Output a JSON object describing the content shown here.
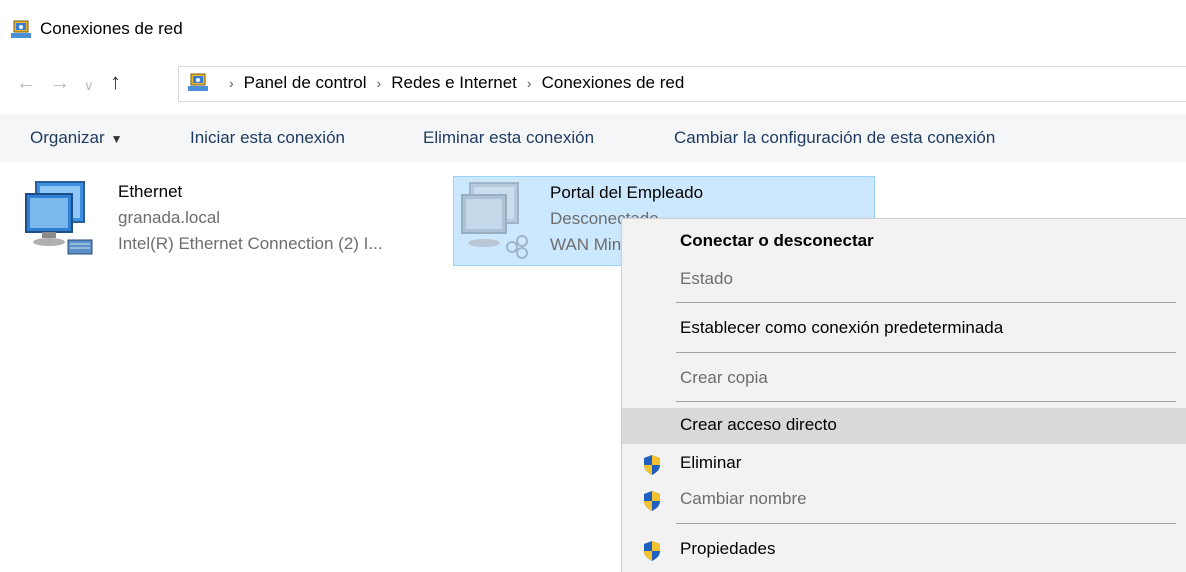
{
  "window": {
    "title": "Conexiones de red"
  },
  "address": {
    "crumbs": [
      "Panel de control",
      "Redes e Internet",
      "Conexiones de red"
    ]
  },
  "nav": {
    "back": "←",
    "forward": "→",
    "recent": "∨",
    "up": "↑"
  },
  "toolbar": {
    "organize": "Organizar",
    "start": "Iniciar esta conexión",
    "delete": "Eliminar esta conexión",
    "change": "Cambiar la configuración de esta conexión"
  },
  "connections": [
    {
      "name": "Ethernet",
      "line1": "granada.local",
      "line2": "Intel(R) Ethernet Connection (2) I..."
    },
    {
      "name": "Portal del Empleado",
      "line1": "Desconectado",
      "line2": "WAN Miniport (PPTP)"
    }
  ],
  "context_menu": {
    "connect": "Conectar o desconectar",
    "status": "Estado",
    "set_default": "Establecer como conexión predeterminada",
    "copy": "Crear copia",
    "shortcut": "Crear acceso directo",
    "delete": "Eliminar",
    "rename": "Cambiar nombre",
    "properties": "Propiedades"
  },
  "colors": {
    "selection": "#cce8ff",
    "selection_border": "#99d1ff",
    "menu_bg": "#f2f2f2",
    "hover": "#d9d9d9"
  }
}
